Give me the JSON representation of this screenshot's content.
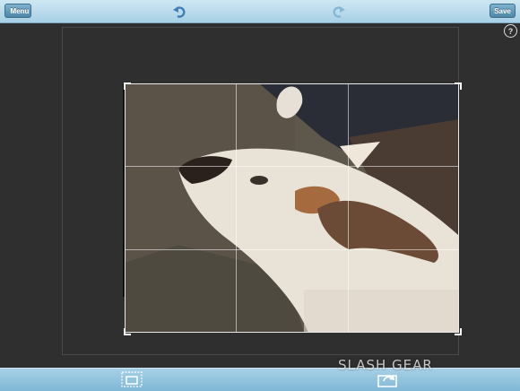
{
  "toolbar": {
    "menu_label": "Menu",
    "save_label": "Save",
    "undo_icon": "undo-arrow-icon",
    "redo_icon": "redo-arrow-icon",
    "help_label": "?"
  },
  "canvas": {
    "photo_subject": "dog-photo",
    "grid": "rule-of-thirds"
  },
  "bottom_toolbar": {
    "tools": [
      "crop-tool-icon",
      "rotate-tool-icon"
    ]
  },
  "watermark": {
    "text": "SLASH GEAR"
  },
  "colors": {
    "toolbar": "#a7d0e6",
    "button": "#4c86a8",
    "background": "#2f2f2f"
  }
}
